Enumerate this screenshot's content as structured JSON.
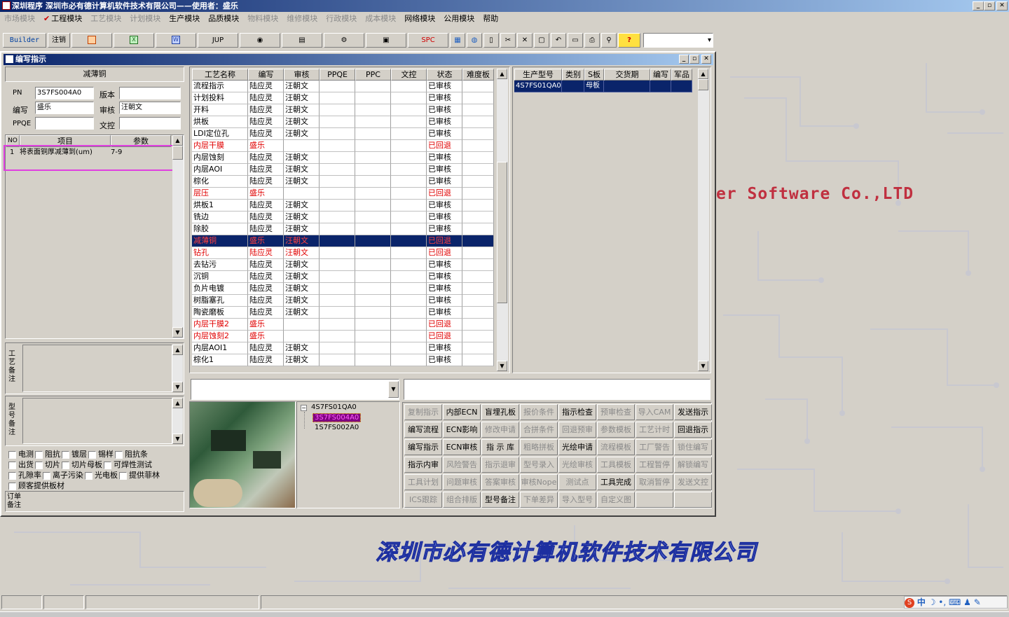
{
  "app": {
    "title": "深圳程序  深圳市必有德计算机软件技术有限公司——使用者：盛乐",
    "menus": [
      {
        "label": "市场模块",
        "enabled": false
      },
      {
        "label": "工程模块",
        "enabled": true,
        "checked": true
      },
      {
        "label": "工艺模块",
        "enabled": false
      },
      {
        "label": "计划模块",
        "enabled": false
      },
      {
        "label": "生产模块",
        "enabled": true
      },
      {
        "label": "品质模块",
        "enabled": true
      },
      {
        "label": "物料模块",
        "enabled": false
      },
      {
        "label": "维修模块",
        "enabled": false
      },
      {
        "label": "行政模块",
        "enabled": false
      },
      {
        "label": "成本模块",
        "enabled": false
      },
      {
        "label": "网络模块",
        "enabled": true
      },
      {
        "label": "公用模块",
        "enabled": true
      },
      {
        "label": "帮助",
        "enabled": true
      }
    ],
    "toolbar": {
      "builder": "Builder",
      "logout": "注销",
      "jup": "JUP",
      "spc": "SPC",
      "icons": [
        "powerpoint-icon",
        "excel-icon",
        "word-icon",
        "eye-icon",
        "cabinet-icon",
        "network-icon",
        "computer-icon",
        "calculator-icon",
        "globe-icon",
        "new-file-icon",
        "cut-icon",
        "close-icon",
        "save-icon",
        "undo-icon",
        "preview-icon",
        "print-icon",
        "find-icon",
        "help-icon"
      ]
    },
    "background_text": "er Software Co.,LTD",
    "background_company": "深圳市必有德计算机软件技术有限公司"
  },
  "window": {
    "title": "编写指示",
    "left": {
      "header": "减薄铜",
      "labels": {
        "pn": "PN",
        "version": "版本",
        "writer": "编写",
        "reviewer": "审核",
        "ppqe": "PPQE",
        "doc_control": "文控"
      },
      "values": {
        "pn": "3S7FS004A0",
        "version": "",
        "writer": "盛乐",
        "reviewer": "汪朝文",
        "ppqe": "",
        "doc_control": ""
      },
      "item_grid": {
        "columns": [
          "NO",
          "项目",
          "参数"
        ],
        "rows": [
          {
            "no": "1",
            "item": "将表面铜厚减薄到(um)",
            "param": "7-9"
          }
        ]
      },
      "process_note_label": "工艺备注",
      "model_note_label": "型号备注",
      "checkboxes": [
        [
          "电测",
          "阻抗",
          "镀层",
          "锡样",
          "阻抗条"
        ],
        [
          "出货",
          "切片",
          "切片母板",
          "可焊性测试"
        ],
        [
          "孔隙率",
          "离子污染",
          "光电板",
          "提供菲林"
        ],
        [
          "顾客提供板材"
        ]
      ],
      "order_note_label": "订单备注"
    },
    "process_grid": {
      "columns": [
        "工艺名称",
        "编写",
        "审核",
        "PPQE",
        "PPC",
        "文控",
        "状态",
        "难度板"
      ],
      "rows": [
        {
          "name": "流程指示",
          "writer": "陆应灵",
          "reviewer": "汪朝文",
          "status": "已审核",
          "flag": "normal"
        },
        {
          "name": "计划投料",
          "writer": "陆应灵",
          "reviewer": "汪朝文",
          "status": "已审核",
          "flag": "normal"
        },
        {
          "name": "开料",
          "writer": "陆应灵",
          "reviewer": "汪朝文",
          "status": "已审核",
          "flag": "normal"
        },
        {
          "name": "烘板",
          "writer": "陆应灵",
          "reviewer": "汪朝文",
          "status": "已审核",
          "flag": "normal"
        },
        {
          "name": "LDI定位孔",
          "writer": "陆应灵",
          "reviewer": "汪朝文",
          "status": "已审核",
          "flag": "normal"
        },
        {
          "name": "内层干膜",
          "writer": "盛乐",
          "reviewer": "",
          "status": "已回退",
          "flag": "returned"
        },
        {
          "name": "内层蚀刻",
          "writer": "陆应灵",
          "reviewer": "汪朝文",
          "status": "已审核",
          "flag": "normal"
        },
        {
          "name": "内层AOI",
          "writer": "陆应灵",
          "reviewer": "汪朝文",
          "status": "已审核",
          "flag": "normal"
        },
        {
          "name": "棕化",
          "writer": "陆应灵",
          "reviewer": "汪朝文",
          "status": "已审核",
          "flag": "normal"
        },
        {
          "name": "层压",
          "writer": "盛乐",
          "reviewer": "",
          "status": "已回退",
          "flag": "returned"
        },
        {
          "name": "烘板1",
          "writer": "陆应灵",
          "reviewer": "汪朝文",
          "status": "已审核",
          "flag": "normal"
        },
        {
          "name": "铣边",
          "writer": "陆应灵",
          "reviewer": "汪朝文",
          "status": "已审核",
          "flag": "normal"
        },
        {
          "name": "除胶",
          "writer": "陆应灵",
          "reviewer": "汪朝文",
          "status": "已审核",
          "flag": "normal"
        },
        {
          "name": "减薄铜",
          "writer": "盛乐",
          "reviewer": "汪朝文",
          "status": "已回退",
          "flag": "selected"
        },
        {
          "name": "钻孔",
          "writer": "陆应灵",
          "reviewer": "汪朝文",
          "status": "已回退",
          "flag": "returned"
        },
        {
          "name": "去钻污",
          "writer": "陆应灵",
          "reviewer": "汪朝文",
          "status": "已审核",
          "flag": "normal"
        },
        {
          "name": "沉铜",
          "writer": "陆应灵",
          "reviewer": "汪朝文",
          "status": "已审核",
          "flag": "normal"
        },
        {
          "name": "负片电镀",
          "writer": "陆应灵",
          "reviewer": "汪朝文",
          "status": "已审核",
          "flag": "normal"
        },
        {
          "name": "树脂塞孔",
          "writer": "陆应灵",
          "reviewer": "汪朝文",
          "status": "已审核",
          "flag": "normal"
        },
        {
          "name": "陶瓷磨板",
          "writer": "陆应灵",
          "reviewer": "汪朝文",
          "status": "已审核",
          "flag": "normal"
        },
        {
          "name": "内层干膜2",
          "writer": "盛乐",
          "reviewer": "",
          "status": "已回退",
          "flag": "returned"
        },
        {
          "name": "内层蚀刻2",
          "writer": "盛乐",
          "reviewer": "",
          "status": "已回退",
          "flag": "returned"
        },
        {
          "name": "内层AOI1",
          "writer": "陆应灵",
          "reviewer": "汪朝文",
          "status": "已审核",
          "flag": "normal"
        },
        {
          "name": "棕化1",
          "writer": "陆应灵",
          "reviewer": "汪朝文",
          "status": "已审核",
          "flag": "normal"
        }
      ]
    },
    "model_grid": {
      "columns": [
        "生产型号",
        "类别",
        "S板",
        "交货期",
        "编写",
        "军品"
      ],
      "rows": [
        {
          "model": "4S7FS01QA0",
          "category": "",
          "s_board": "母板",
          "delivery": "",
          "writer": "",
          "military": ""
        }
      ]
    },
    "tree": {
      "root": "4S7FS01QA0",
      "children": [
        {
          "label": "3S7FS004A0",
          "selected": true
        },
        {
          "label": "1S7FS002A0",
          "selected": false
        }
      ]
    },
    "buttons": [
      [
        {
          "label": "复制指示",
          "enabled": false
        },
        {
          "label": "内部ECN",
          "enabled": true
        },
        {
          "label": "盲埋孔板",
          "enabled": true
        },
        {
          "label": "报价条件",
          "enabled": false
        },
        {
          "label": "指示检查",
          "enabled": true
        },
        {
          "label": "预审检查",
          "enabled": false
        },
        {
          "label": "导入CAM",
          "enabled": false
        },
        {
          "label": "发送指示",
          "enabled": true
        }
      ],
      [
        {
          "label": "编写流程",
          "enabled": true
        },
        {
          "label": "ECN影响",
          "enabled": true
        },
        {
          "label": "修改申请",
          "enabled": false
        },
        {
          "label": "合拼条件",
          "enabled": false
        },
        {
          "label": "回退预审",
          "enabled": false
        },
        {
          "label": "参数模板",
          "enabled": false
        },
        {
          "label": "工艺计时",
          "enabled": false
        },
        {
          "label": "回退指示",
          "enabled": true
        }
      ],
      [
        {
          "label": "编写指示",
          "enabled": true
        },
        {
          "label": "ECN审核",
          "enabled": true
        },
        {
          "label": "指 示 库",
          "enabled": true
        },
        {
          "label": "粗略拼板",
          "enabled": false
        },
        {
          "label": "光绘申请",
          "enabled": true
        },
        {
          "label": "流程模板",
          "enabled": false
        },
        {
          "label": "工厂警告",
          "enabled": false
        },
        {
          "label": "锁住编写",
          "enabled": false
        }
      ],
      [
        {
          "label": "指示内审",
          "enabled": true
        },
        {
          "label": "风险警告",
          "enabled": false
        },
        {
          "label": "指示退审",
          "enabled": false
        },
        {
          "label": "型号录入",
          "enabled": false
        },
        {
          "label": "光绘审核",
          "enabled": false
        },
        {
          "label": "工具模板",
          "enabled": false
        },
        {
          "label": "工程暂停",
          "enabled": false
        },
        {
          "label": "解锁编写",
          "enabled": false
        }
      ],
      [
        {
          "label": "工具计划",
          "enabled": false
        },
        {
          "label": "问题审核",
          "enabled": false
        },
        {
          "label": "答案审核",
          "enabled": false
        },
        {
          "label": "审核Nope",
          "enabled": false
        },
        {
          "label": "测试点",
          "enabled": false
        },
        {
          "label": "工具完成",
          "enabled": true
        },
        {
          "label": "取消暂停",
          "enabled": false
        },
        {
          "label": "发送文控",
          "enabled": false
        }
      ],
      [
        {
          "label": "ICS跟踪",
          "enabled": false
        },
        {
          "label": "组合排版",
          "enabled": false
        },
        {
          "label": "型号备注",
          "enabled": true
        },
        {
          "label": "下单差异",
          "enabled": false
        },
        {
          "label": "导入型号",
          "enabled": false
        },
        {
          "label": "自定义图",
          "enabled": false
        },
        {
          "label": "",
          "enabled": false
        },
        {
          "label": "",
          "enabled": false
        }
      ]
    ]
  },
  "tray": {
    "ime": "中"
  }
}
